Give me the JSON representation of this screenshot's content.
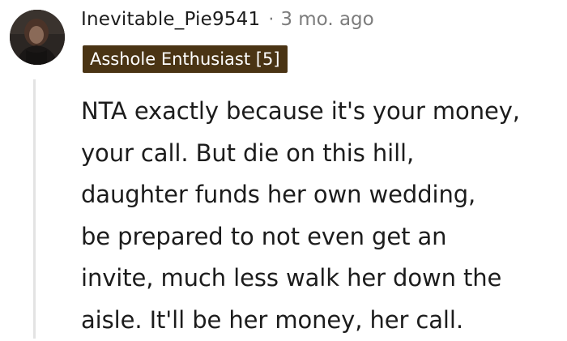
{
  "comment": {
    "username": "Inevitable_Pie9541",
    "separator": "·",
    "timestamp": "3 mo. ago",
    "flair": "Asshole Enthusiast [5]",
    "flair_color": "#4a3414",
    "avatar_icon": "user-avatar",
    "body_lines": [
      "NTA exactly because it's your money,",
      "your call. But die on this hill,",
      "daughter funds her own wedding,",
      "be prepared to not even get an",
      "invite, much less walk her down the",
      "aisle. It'll be her money, her call."
    ]
  }
}
